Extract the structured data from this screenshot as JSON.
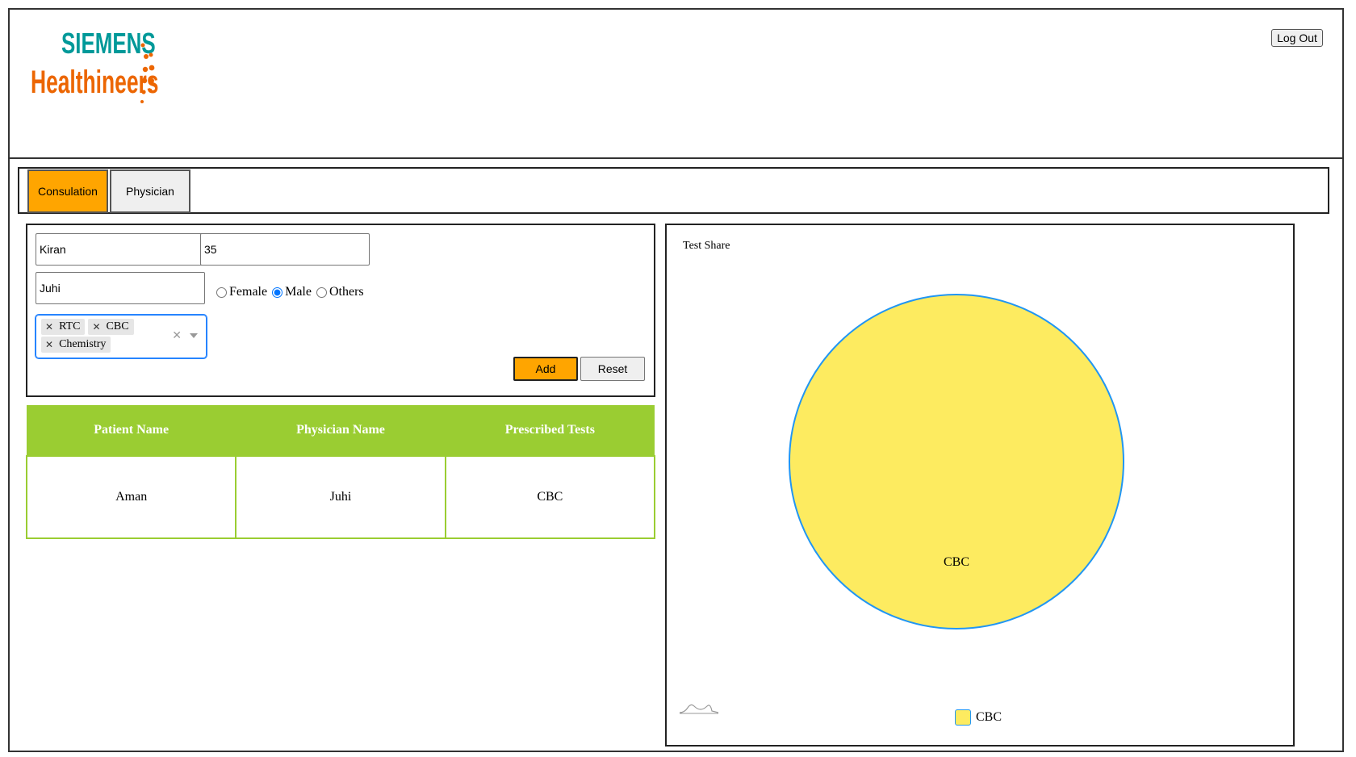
{
  "header": {
    "brand_top": "SIEMENS",
    "brand_bottom": "Healthineers",
    "logout_label": "Log Out"
  },
  "tabs": [
    {
      "label": "Consulation",
      "active": true
    },
    {
      "label": "Physician",
      "active": false
    }
  ],
  "form": {
    "patient_name_value": "Kiran",
    "age_value": "35",
    "physician_value": "Juhi",
    "gender_options": [
      "Female",
      "Male",
      "Others"
    ],
    "gender_selected": "Male",
    "selected_tests": [
      "RTC",
      "CBC",
      "Chemistry"
    ],
    "add_label": "Add",
    "reset_label": "Reset"
  },
  "table": {
    "headers": [
      "Patient Name",
      "Physician Name",
      "Prescribed Tests"
    ],
    "rows": [
      [
        "Aman",
        "Juhi",
        "CBC"
      ]
    ]
  },
  "chart_data": {
    "type": "pie",
    "title": "Test Share",
    "categories": [
      "CBC"
    ],
    "values": [
      1
    ],
    "colors": [
      "#fdeb60"
    ],
    "border_color": "#2196f3",
    "legend": [
      "CBC"
    ],
    "legend_position": "bottom"
  }
}
